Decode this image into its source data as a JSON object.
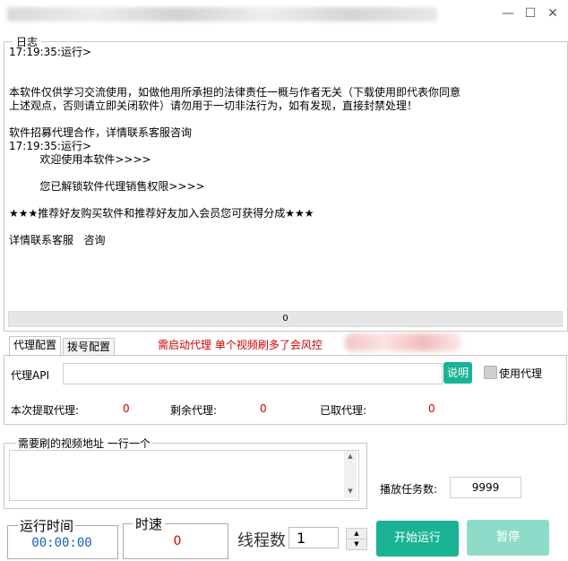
{
  "window": {
    "title_blurred": true
  },
  "log": {
    "legend": "日志",
    "text": "17:19:35:运行>\n\n\n本软件仅供学习交流使用，如做他用所承担的法律责任一概与作者无关（下载使用即代表你同意\n上述观点，否则请立即关闭软件）请勿用于一切非法行为，如有发现，直接封禁处理！\n\n软件招募代理合作，详情联系客服咨询\n17:19:35:运行>\n         欢迎使用本软件>>>>\n\n         您已解锁软件代理销售权限>>>>\n\n★★★推荐好友购买软件和推荐好友加入会员您可获得分成★★★\n\n详情联系客服   咨询",
    "progress_value": "0"
  },
  "tabs": [
    {
      "label": "代理配置",
      "active": true
    },
    {
      "label": "拨号配置",
      "active": false
    }
  ],
  "tab_warning": "需启动代理 单个视频刷多了会风控",
  "proxy": {
    "api_label": "代理API",
    "api_value": "",
    "help_button": "说明",
    "use_proxy_label": "使用代理",
    "use_proxy_checked": false,
    "fetched_label": "本次提取代理:",
    "fetched_value": "0",
    "remaining_label": "剩余代理:",
    "remaining_value": "0",
    "taken_label": "已取代理:",
    "taken_value": "0"
  },
  "urls": {
    "legend": "需要刷的视频地址  一行一个",
    "value": ""
  },
  "task": {
    "label": "播放任务数:",
    "value": "9999"
  },
  "stats": {
    "runtime_label": "运行时间",
    "runtime_value": "00:00:00",
    "speed_label": "时速",
    "speed_value": "0",
    "threads_label": "线程数",
    "threads_value": "1"
  },
  "buttons": {
    "start": "开始运行",
    "pause": "暂停"
  },
  "colors": {
    "accent": "#1ab394",
    "accent_disabled": "#8fdbc9",
    "warning": "#d40000",
    "runtime": "#1a5fb4"
  }
}
